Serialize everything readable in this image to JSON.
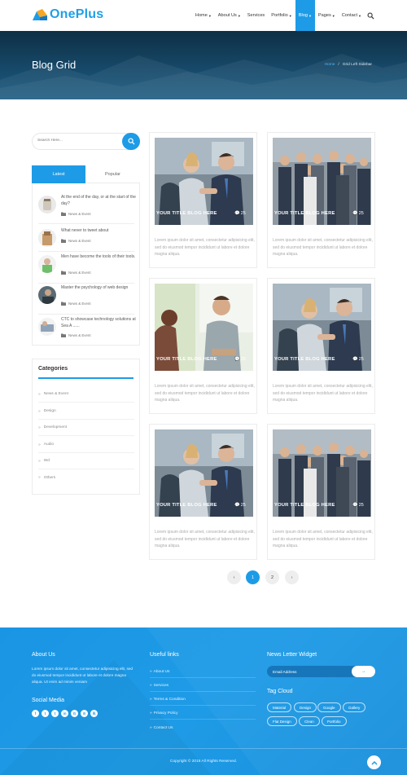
{
  "brand": {
    "name": "OnePlus",
    "accent": "#1e9be6"
  },
  "nav": {
    "items": [
      {
        "label": "Home",
        "caret": true,
        "active": false
      },
      {
        "label": "About Us",
        "caret": true,
        "active": false
      },
      {
        "label": "Services",
        "caret": false,
        "active": false
      },
      {
        "label": "Portfolio",
        "caret": true,
        "active": false
      },
      {
        "label": "Blog",
        "caret": true,
        "active": true
      },
      {
        "label": "Pages",
        "caret": true,
        "active": false
      },
      {
        "label": "Contact",
        "caret": true,
        "active": false
      }
    ],
    "search_icon": "search-icon"
  },
  "banner": {
    "title": "Blog Grid",
    "breadcrumb_home": "Home",
    "breadcrumb_sep": "/",
    "breadcrumb_current": "Grid Left Sidebar"
  },
  "sidebar": {
    "search_placeholder": "Search Here...",
    "tabs": {
      "latest": "Latest",
      "popular": "Popular"
    },
    "posts": [
      {
        "title": "At the end of the day, or at the start of the day?",
        "meta": "News & Event"
      },
      {
        "title": "What never to tweet about",
        "meta": "News & Event"
      },
      {
        "title": "Men have become the tools of their tools.",
        "meta": "News & Event"
      },
      {
        "title": "Master the psychology of web design",
        "meta": "News & Event"
      },
      {
        "title": "CTC to showcase technology solutions at Sea A ......",
        "meta": "News & Event"
      }
    ],
    "categories_title": "Categories",
    "categories": [
      "News & Event",
      "Design",
      "Development",
      "Audio",
      "Wd",
      "Others"
    ]
  },
  "cards": [
    {
      "caption": "YOUR TITLE BLOG HERE",
      "comments": "25",
      "text": "Lorem ipsum dolor sit amet, consectetur adipisicing elit, sed do eiusmod tempor incididunt ut labore et dolore magna aliqua.",
      "image": "handshake"
    },
    {
      "caption": "YOUR TITLE BLOG HERE",
      "comments": "25",
      "text": "Lorem ipsum dolor sit amet, consectetur adipisicing elit, sed do eiusmod tempor incididunt ut labore et dolore magna aliqua.",
      "image": "team"
    },
    {
      "caption": "YOUR TITLE BLOG HERE",
      "comments": "25",
      "text": "Lorem ipsum dolor sit amet, consectetur adipisicing elit, sed do eiusmod tempor incididunt ut labore et dolore magna aliqua.",
      "image": "meeting"
    },
    {
      "caption": "YOUR TITLE BLOG HERE",
      "comments": "25",
      "text": "Lorem ipsum dolor sit amet, consectetur adipisicing elit, sed do eiusmod tempor incididunt ut labore et dolore magna aliqua.",
      "image": "handshake"
    },
    {
      "caption": "YOUR TITLE BLOG HERE",
      "comments": "25",
      "text": "Lorem ipsum dolor sit amet, consectetur adipisicing elit, sed do eiusmod tempor incididunt ut labore et dolore magna aliqua.",
      "image": "handshake"
    },
    {
      "caption": "YOUR TITLE BLOG HERE",
      "comments": "25",
      "text": "Lorem ipsum dolor sit amet, consectetur adipisicing elit, sed do eiusmod tempor incididunt ut labore et dolore magna aliqua.",
      "image": "team"
    }
  ],
  "pagination": {
    "prev": "‹",
    "pages": [
      "1",
      "2"
    ],
    "active": "1",
    "next": "›"
  },
  "footer": {
    "about_title": "About Us",
    "about_text": "Lorem ipsum dolor sit amet, consectetur adipisicing elit, sed do eiusmod tempor incididunt ut labore et dolore magna aliqua. Ut enim ad minim veniam",
    "social_title": "Social Media",
    "social": [
      "f",
      "t",
      "t",
      "in",
      "G",
      "⊙",
      "ℝ"
    ],
    "links_title": "Useful links",
    "links": [
      "About Us",
      "Services",
      "Terms & Condition",
      "Privacy Policy",
      "Contact Us"
    ],
    "newsletter_title": "News Letter Widget",
    "email_placeholder": "Email Address",
    "submit": "→",
    "tag_title": "Tag Cloud",
    "tags": [
      "Material",
      "Design",
      "Google",
      "Gallery",
      "Flat Design",
      "Clean",
      "Portfolio"
    ],
    "copyright": "Copyright © 2016 All Rights Reserved."
  }
}
